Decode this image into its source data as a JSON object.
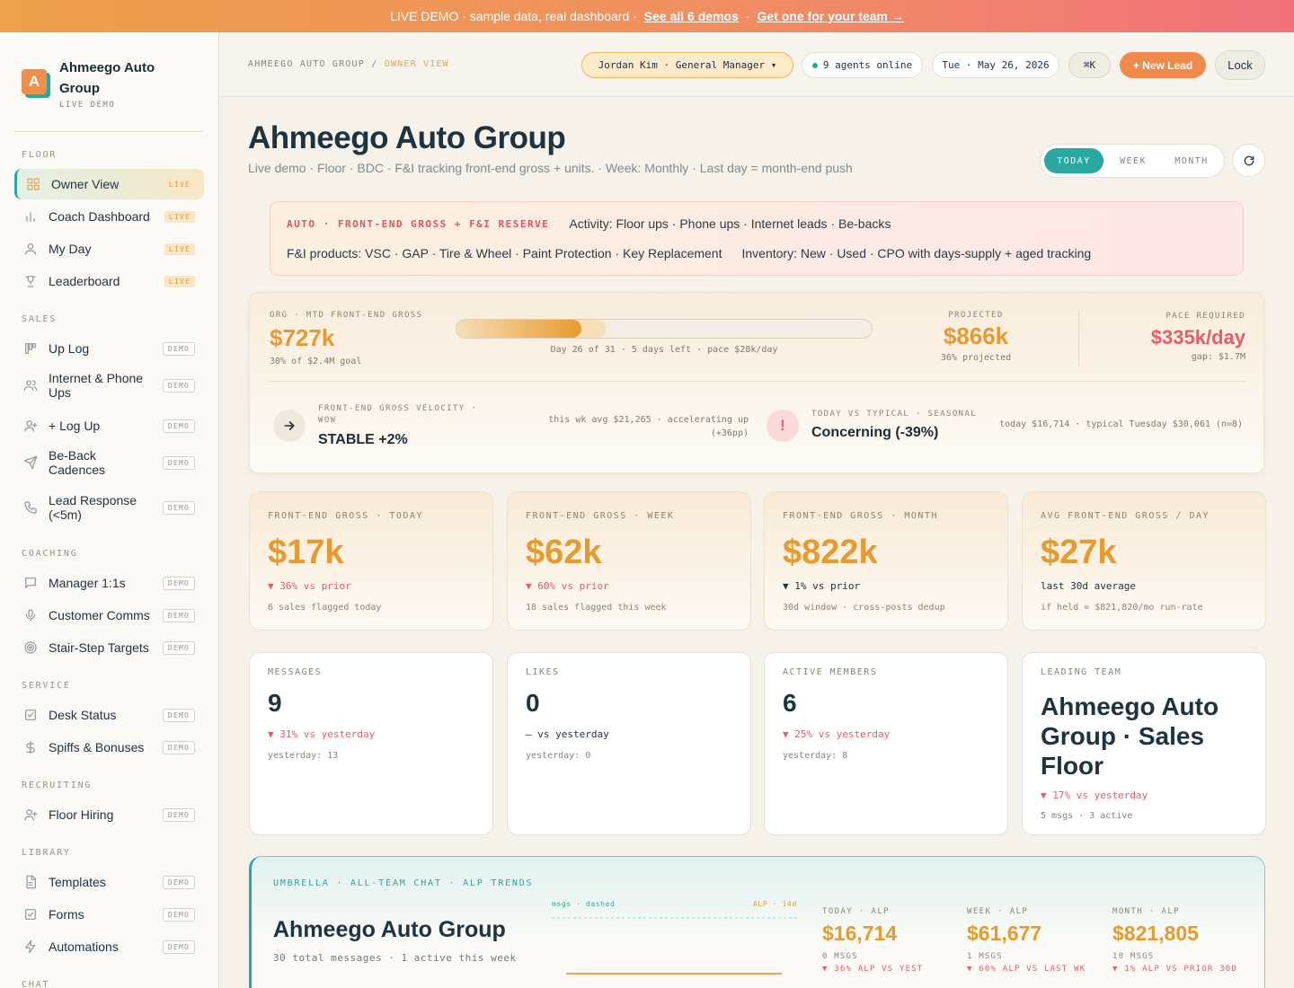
{
  "banner": {
    "text": "LIVE DEMO · sample data, real dashboard ·",
    "link1": "See all 6 demos",
    "sep": "·",
    "link2": "Get one for your team →"
  },
  "brand": {
    "logo_letter": "A",
    "name": "Ahmeego Auto Group",
    "sub": "LIVE DEMO"
  },
  "sidebar": {
    "sections": {
      "floor": "FLOOR",
      "sales": "SALES",
      "coaching": "COACHING",
      "service": "SERVICE",
      "recruiting": "RECRUITING",
      "library": "LIBRARY",
      "chat": "CHAT"
    },
    "items": [
      {
        "label": "Owner View",
        "tag": "LIVE",
        "icon": "grid-icon"
      },
      {
        "label": "Coach Dashboard",
        "tag": "LIVE",
        "icon": "bar-chart-icon"
      },
      {
        "label": "My Day",
        "tag": "LIVE",
        "icon": "user-icon"
      },
      {
        "label": "Leaderboard",
        "tag": "LIVE",
        "icon": "trophy-icon"
      },
      {
        "label": "Up Log",
        "tag": "DEMO",
        "icon": "kanban-icon"
      },
      {
        "label": "Internet & Phone Ups",
        "tag": "DEMO",
        "icon": "users-icon"
      },
      {
        "label": "+ Log Up",
        "tag": "DEMO",
        "icon": "user-plus-icon"
      },
      {
        "label": "Be-Back Cadences",
        "tag": "DEMO",
        "icon": "send-icon"
      },
      {
        "label": "Lead Response (<5m)",
        "tag": "DEMO",
        "icon": "phone-icon"
      },
      {
        "label": "Manager 1:1s",
        "tag": "DEMO",
        "icon": "message-icon"
      },
      {
        "label": "Customer Comms",
        "tag": "DEMO",
        "icon": "mic-icon"
      },
      {
        "label": "Stair-Step Targets",
        "tag": "DEMO",
        "icon": "target-icon"
      },
      {
        "label": "Desk Status",
        "tag": "DEMO",
        "icon": "checkbox-icon"
      },
      {
        "label": "Spiffs & Bonuses",
        "tag": "DEMO",
        "icon": "dollar-icon"
      },
      {
        "label": "Floor Hiring",
        "tag": "DEMO",
        "icon": "user-plus-icon"
      },
      {
        "label": "Templates",
        "tag": "DEMO",
        "icon": "file-icon"
      },
      {
        "label": "Forms",
        "tag": "DEMO",
        "icon": "checkbox-icon"
      },
      {
        "label": "Automations",
        "tag": "DEMO",
        "icon": "bolt-icon"
      }
    ]
  },
  "topbar": {
    "crumb_root": "AHMEEGO AUTO GROUP",
    "crumb_sep": "/",
    "crumb_current": "OWNER VIEW",
    "user": "Jordan Kim · General Manager ▾",
    "agents": "9 agents online",
    "date": "Tue · May 26, 2026",
    "cmdk": "⌘K",
    "new_lead": "+ New Lead",
    "lock": "Lock"
  },
  "header": {
    "title": "Ahmeego Auto Group",
    "subtitle": "Live demo · Floor · BDC · F&I tracking front-end gross + units. · Week: Monthly · Last day = month-end push",
    "range": {
      "today": "TODAY",
      "week": "WEEK",
      "month": "MONTH",
      "selected": "TODAY"
    }
  },
  "info": {
    "kicker": "AUTO · FRONT-END GROSS + F&I RESERVE",
    "activity": "Activity: Floor ups · Phone ups · Internet leads · Be-backs",
    "fi": "F&I products: VSC · GAP · Tire & Wheel · Paint Protection · Key Replacement",
    "inventory": "Inventory: New · Used · CPO with days-supply + aged tracking"
  },
  "goal": {
    "label": "ORG · MTD FRONT-END GROSS",
    "value": "$727k",
    "of_goal": "30% of $2.4M goal",
    "progress_pct": 30,
    "projected_pct": 36,
    "progress_caption": "Day 26 of 31 · 5 days left · pace $28k/day",
    "projected_label": "PROJECTED",
    "projected_value": "$866k",
    "projected_note": "36% projected",
    "pace_label": "PACE REQUIRED",
    "pace_value": "$335k/day",
    "pace_gap": "gap: $1.7M",
    "velocity_label": "FRONT-END GROSS VELOCITY · WOW",
    "velocity_value": "STABLE +2%",
    "velocity_note": "this wk avg $21,265 · accelerating up (+36pp)",
    "typical_label": "TODAY VS TYPICAL · SEASONAL",
    "typical_value": "Concerning (-39%)",
    "typical_note": "today $16,714 · typical Tuesday $30,061 (n=8)"
  },
  "kpis": [
    {
      "label": "FRONT-END GROSS · TODAY",
      "value": "$17k",
      "delta": "▼ 36% vs prior",
      "note": "6 sales flagged today",
      "neutral": false
    },
    {
      "label": "FRONT-END GROSS · WEEK",
      "value": "$62k",
      "delta": "▼ 60% vs prior",
      "note": "18 sales flagged this week",
      "neutral": false
    },
    {
      "label": "FRONT-END GROSS · MONTH",
      "value": "$822k",
      "delta": "▼ 1% vs prior",
      "note": "30d window · cross-posts dedup",
      "neutral": true
    },
    {
      "label": "AVG FRONT-END GROSS / DAY",
      "value": "$27k",
      "delta": "last 30d average",
      "note": "if held = $821,820/mo run-rate",
      "neutral": true
    }
  ],
  "stats": [
    {
      "label": "MESSAGES",
      "value": "9",
      "delta": "▼ 31% vs yesterday",
      "note": "yesterday: 13"
    },
    {
      "label": "LIKES",
      "value": "0",
      "delta": "— vs yesterday",
      "note": "yesterday: 0"
    },
    {
      "label": "ACTIVE MEMBERS",
      "value": "6",
      "delta": "▼ 25% vs yesterday",
      "note": "yesterday: 8"
    },
    {
      "label": "LEADING TEAM",
      "value": "Ahmeego Auto Group · Sales Floor",
      "delta": "▼ 17% vs yesterday",
      "note": "5 msgs · 3 active"
    }
  ],
  "umbrella": {
    "kicker": "UMBRELLA · ALL-TEAM CHAT · ALP TRENDS",
    "title": "Ahmeego Auto Group",
    "sub": "30 total messages · 1 active this week",
    "legend_msgs": "msgs · dashed",
    "legend_alp": "ALP · 14d",
    "cols": [
      {
        "label": "TODAY · ALP",
        "value": "$16,714",
        "msgs": "0 MSGS",
        "delta": "▼ 36% ALP VS YEST"
      },
      {
        "label": "WEEK · ALP",
        "value": "$61,677",
        "msgs": "1 MSGS",
        "delta": "▼ 60% ALP VS LAST WK"
      },
      {
        "label": "MONTH · ALP",
        "value": "$821,805",
        "msgs": "10 MSGS",
        "delta": "▼ 1% ALP VS PRIOR 30D"
      }
    ]
  },
  "colors": {
    "accent_teal": "#2aa7a0",
    "accent_orange": "#e79a2e",
    "danger": "#ea5a68"
  }
}
